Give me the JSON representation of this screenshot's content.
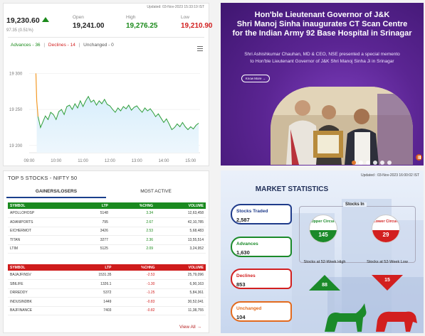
{
  "index": {
    "updated": "Updated: 03-Nov-2023 15:33:19 IST",
    "value": "19,230.60",
    "change": "97.35 (0.51%)",
    "open_label": "Open",
    "open": "19,241.00",
    "high_label": "High",
    "high": "19,276.25",
    "low_label": "Low",
    "low": "19,210.90",
    "advances": "Advances - 36",
    "declines": "Declines - 14",
    "unchanged": "Unchanged - 0",
    "colors": {
      "up": "#1b8a1b",
      "down": "#d21f1f"
    }
  },
  "chart_data": {
    "type": "area",
    "x_ticks": [
      "09:00",
      "10:00",
      "11:00",
      "12:00",
      "13:00",
      "14:00",
      "15:00"
    ],
    "y_ticks": [
      "19 300",
      "19 250",
      "19 200"
    ],
    "ylim": [
      19190,
      19320
    ],
    "series": [
      {
        "values": [
          [
            9.25,
            19300
          ],
          [
            9.28,
            19262
          ],
          [
            9.33,
            19240
          ],
          [
            9.42,
            19225
          ],
          [
            9.5,
            19232
          ],
          [
            9.6,
            19241
          ],
          [
            9.7,
            19236
          ],
          [
            9.8,
            19246
          ],
          [
            9.9,
            19243
          ],
          [
            10.0,
            19236
          ],
          [
            10.1,
            19247
          ],
          [
            10.2,
            19250
          ],
          [
            10.3,
            19243
          ],
          [
            10.4,
            19254
          ],
          [
            10.5,
            19256
          ],
          [
            10.6,
            19250
          ],
          [
            10.7,
            19258
          ],
          [
            10.8,
            19252
          ],
          [
            10.9,
            19262
          ],
          [
            11.0,
            19254
          ],
          [
            11.1,
            19262
          ],
          [
            11.2,
            19268
          ],
          [
            11.3,
            19260
          ],
          [
            11.4,
            19263
          ],
          [
            11.5,
            19256
          ],
          [
            11.6,
            19262
          ],
          [
            11.7,
            19258
          ],
          [
            11.8,
            19264
          ],
          [
            11.9,
            19257
          ],
          [
            12.0,
            19255
          ],
          [
            12.1,
            19250
          ],
          [
            12.2,
            19246
          ],
          [
            12.3,
            19252
          ],
          [
            12.4,
            19248
          ],
          [
            12.5,
            19254
          ],
          [
            12.6,
            19251
          ],
          [
            12.7,
            19256
          ],
          [
            12.8,
            19249
          ],
          [
            12.9,
            19253
          ],
          [
            13.0,
            19255
          ],
          [
            13.1,
            19250
          ],
          [
            13.2,
            19246
          ],
          [
            13.3,
            19252
          ],
          [
            13.4,
            19248
          ],
          [
            13.5,
            19251
          ],
          [
            13.6,
            19246
          ],
          [
            13.7,
            19240
          ],
          [
            13.8,
            19244
          ],
          [
            13.9,
            19238
          ],
          [
            14.0,
            19232
          ],
          [
            14.1,
            19237
          ],
          [
            14.2,
            19230
          ],
          [
            14.3,
            19222
          ],
          [
            14.4,
            19225
          ],
          [
            14.5,
            19230
          ],
          [
            14.6,
            19226
          ],
          [
            14.7,
            19232
          ],
          [
            14.8,
            19226
          ],
          [
            14.9,
            19222
          ],
          [
            15.0,
            19226
          ],
          [
            15.1,
            19223
          ],
          [
            15.2,
            19228
          ],
          [
            15.3,
            19231
          ]
        ]
      }
    ],
    "colors": {
      "line": "#2e9e3a",
      "fill_top": "#d8eefb",
      "fill_bottom": "#eef7fd",
      "first_segment": "#f39a28"
    }
  },
  "top5": {
    "title": "TOP 5 STOCKS - NIFTY 50",
    "tab_gainers": "GAINERS/LOSERS",
    "tab_most_active": "MOST ACTIVE",
    "headers": [
      "SYMBOL",
      "LTP",
      "%CHNG",
      "VOLUME"
    ],
    "gainers": [
      [
        "APOLLOHOSP",
        "5148",
        "3.34",
        "12,63,458"
      ],
      [
        "ADANIPORTS",
        "795",
        "2.67",
        "42,10,785"
      ],
      [
        "EICHERMOT",
        "3426",
        "2.53",
        "5,68,483"
      ],
      [
        "TITAN",
        "3277",
        "2.36",
        "13,55,514"
      ],
      [
        "LTIM",
        "5125",
        "2.09",
        "3,24,952"
      ]
    ],
    "losers": [
      [
        "BAJAJFINSV",
        "1531.35",
        "-2.53",
        "25,79,096"
      ],
      [
        "SBILIFE",
        "1326.1",
        "-1.30",
        "6,90,163"
      ],
      [
        "DRREDDY",
        "5372",
        "-1.25",
        "5,84,361"
      ],
      [
        "INDUSINDBK",
        "1449",
        "-0.83",
        "30,52,041"
      ],
      [
        "BAJFINANCE",
        "7403",
        "-0.82",
        "11,38,755"
      ]
    ],
    "view_all": "View All →"
  },
  "banner": {
    "title_line1": "Hon'ble Lieutenant Governor of J&K",
    "title_line2": "Shri Manoj Sinha inaugurates CT Scan Centre",
    "title_line3": "for the Indian Army 92 Base Hospital in Srinagar",
    "desc_line1": "Shri Ashishkumar Chauhan, MD & CEO, NSE presented a special memento",
    "desc_line2": "to Hon'ble Lieutenant Governor of J&K Shri Manoj Sinha Ji in Srinagar",
    "know_more": "Know More →"
  },
  "market": {
    "updated": "Updated : 03-Nov-2023 16:00:02 IST",
    "title": "MARKET STATISTICS",
    "stocks_traded_label": "Stocks Traded",
    "stocks_traded": "2,587",
    "advances_label": "Advances",
    "advances": "1,630",
    "declines_label": "Declines",
    "declines": "853",
    "unchanged_label": "Unchanged",
    "unchanged": "104",
    "stocks_in": "Stocks In",
    "upper_circuit_label": "Upper Circuit",
    "upper_circuit": "145",
    "lower_circuit_label": "Lower Circuit",
    "lower_circuit": "29",
    "wk_high_label": "Stocks at 52-Week High",
    "wk_high": "88",
    "wk_low_label": "Stocks at 52-Week Low",
    "wk_low": "15",
    "colors": {
      "traded": "#1f3b8a",
      "adv": "#1b8a2a",
      "dec": "#d21f1f",
      "unch": "#e36b1e"
    }
  }
}
